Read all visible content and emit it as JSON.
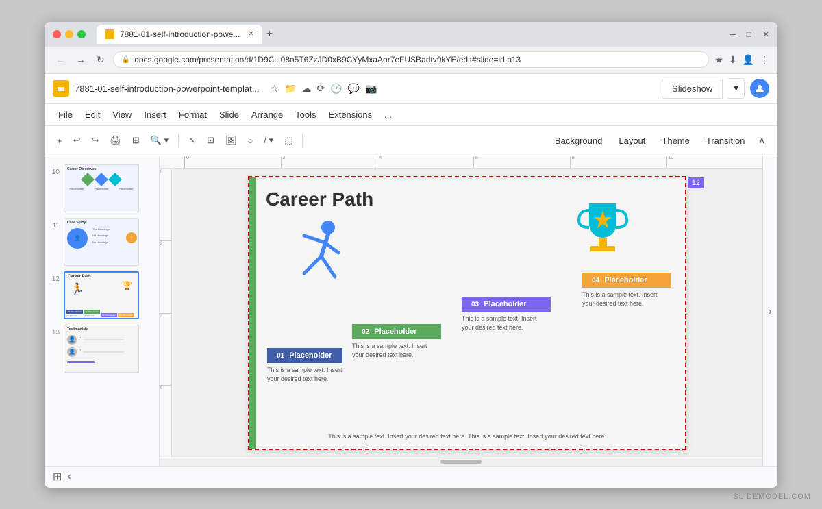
{
  "watermark": "SLIDEMODEL.COM",
  "browser": {
    "tab_title": "7881-01-self-introduction-powe...",
    "new_tab_label": "+",
    "address": "docs.google.com/presentation/d/1D9CiL08o5T6ZzJD0xB9CYyMxaAor7eFUSBarltv9kYE/edit#slide=id.p13",
    "window_controls": [
      "─",
      "□",
      "✕"
    ]
  },
  "appbar": {
    "title": "7881-01-self-introduction-powerpoint-templat...",
    "slideshow_btn": "Slideshow",
    "star_icon": "★",
    "menu": [
      "File",
      "Edit",
      "View",
      "Insert",
      "Format",
      "Slide",
      "Arrange",
      "Tools",
      "Extensions",
      "..."
    ]
  },
  "toolbar": {
    "tools": [
      "+",
      "↩",
      "↪",
      "🖨",
      "⊞",
      "🔍",
      "▾",
      "↖",
      "⊡",
      "🖼",
      "○",
      "/▾",
      "⬚"
    ],
    "right_tools": [
      "Background",
      "Layout",
      "Theme",
      "Transition"
    ],
    "collapse_icon": "∧"
  },
  "slides": [
    {
      "number": "10",
      "label": "Career Objectives slide",
      "type": "career_objectives"
    },
    {
      "number": "11",
      "label": "Case Study slide",
      "type": "case_study"
    },
    {
      "number": "12",
      "label": "Career Path slide",
      "type": "career_path",
      "active": true
    },
    {
      "number": "13",
      "label": "Testimonials slide",
      "type": "testimonials"
    }
  ],
  "main_slide": {
    "badge": "12",
    "title": "Career Path",
    "steps": [
      {
        "num": "01",
        "label": "Placeholder",
        "color": "#3f5da8",
        "text": "This is a sample text. Insert your desired text here."
      },
      {
        "num": "02",
        "label": "Placeholder",
        "color": "#5ba85f",
        "text": "This is a sample text. Insert your desired text here."
      },
      {
        "num": "03",
        "label": "Placeholder",
        "color": "#7b68ee",
        "text": "This is a sample text. Insert your desired text here."
      },
      {
        "num": "04",
        "label": "Placeholder",
        "color": "#f4a23a",
        "text": "This is a sample text. Insert your desired text here."
      }
    ],
    "bottom_text": "This is a sample text. Insert your desired text here. This is a\nsample text. Insert your desired text here."
  },
  "footer": {
    "grid_icon": "⊞",
    "collapse_icon": "‹",
    "right_collapse_icon": "›"
  }
}
